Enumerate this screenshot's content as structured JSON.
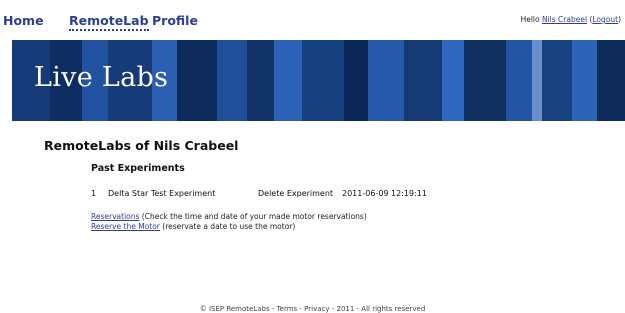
{
  "nav": {
    "home": "Home",
    "remotelab": "RemoteLab",
    "profile": "Profile",
    "greeting": "Hello",
    "user_name": "Nils Crabeel",
    "logout_open": "(",
    "logout": "Logout",
    "logout_close": ")"
  },
  "banner": {
    "title": "Live Labs"
  },
  "main": {
    "title": "RemoteLabs of Nils Crabeel",
    "past_experiments_heading": "Past Experiments",
    "experiments": [
      {
        "id": "1",
        "name": "Delta Star Test Experiment",
        "delete_label": "Delete Experiment",
        "datetime": "2011-06-09 12:19:11"
      }
    ],
    "reservations_link": "Reservations",
    "reservations_desc": " (Check the time and date of your made motor reservations)",
    "reserve_link": "Reserve the Motor",
    "reserve_desc": " (reservate a date to use the motor)"
  },
  "footer": {
    "text": "© ISEP RemoteLabs - Terms - Privacy - 2011 - All rights reserved"
  },
  "colors": {
    "link": "#2c3f95",
    "banner_dark": "#0e2d61",
    "banner_light": "#2f67bf"
  }
}
